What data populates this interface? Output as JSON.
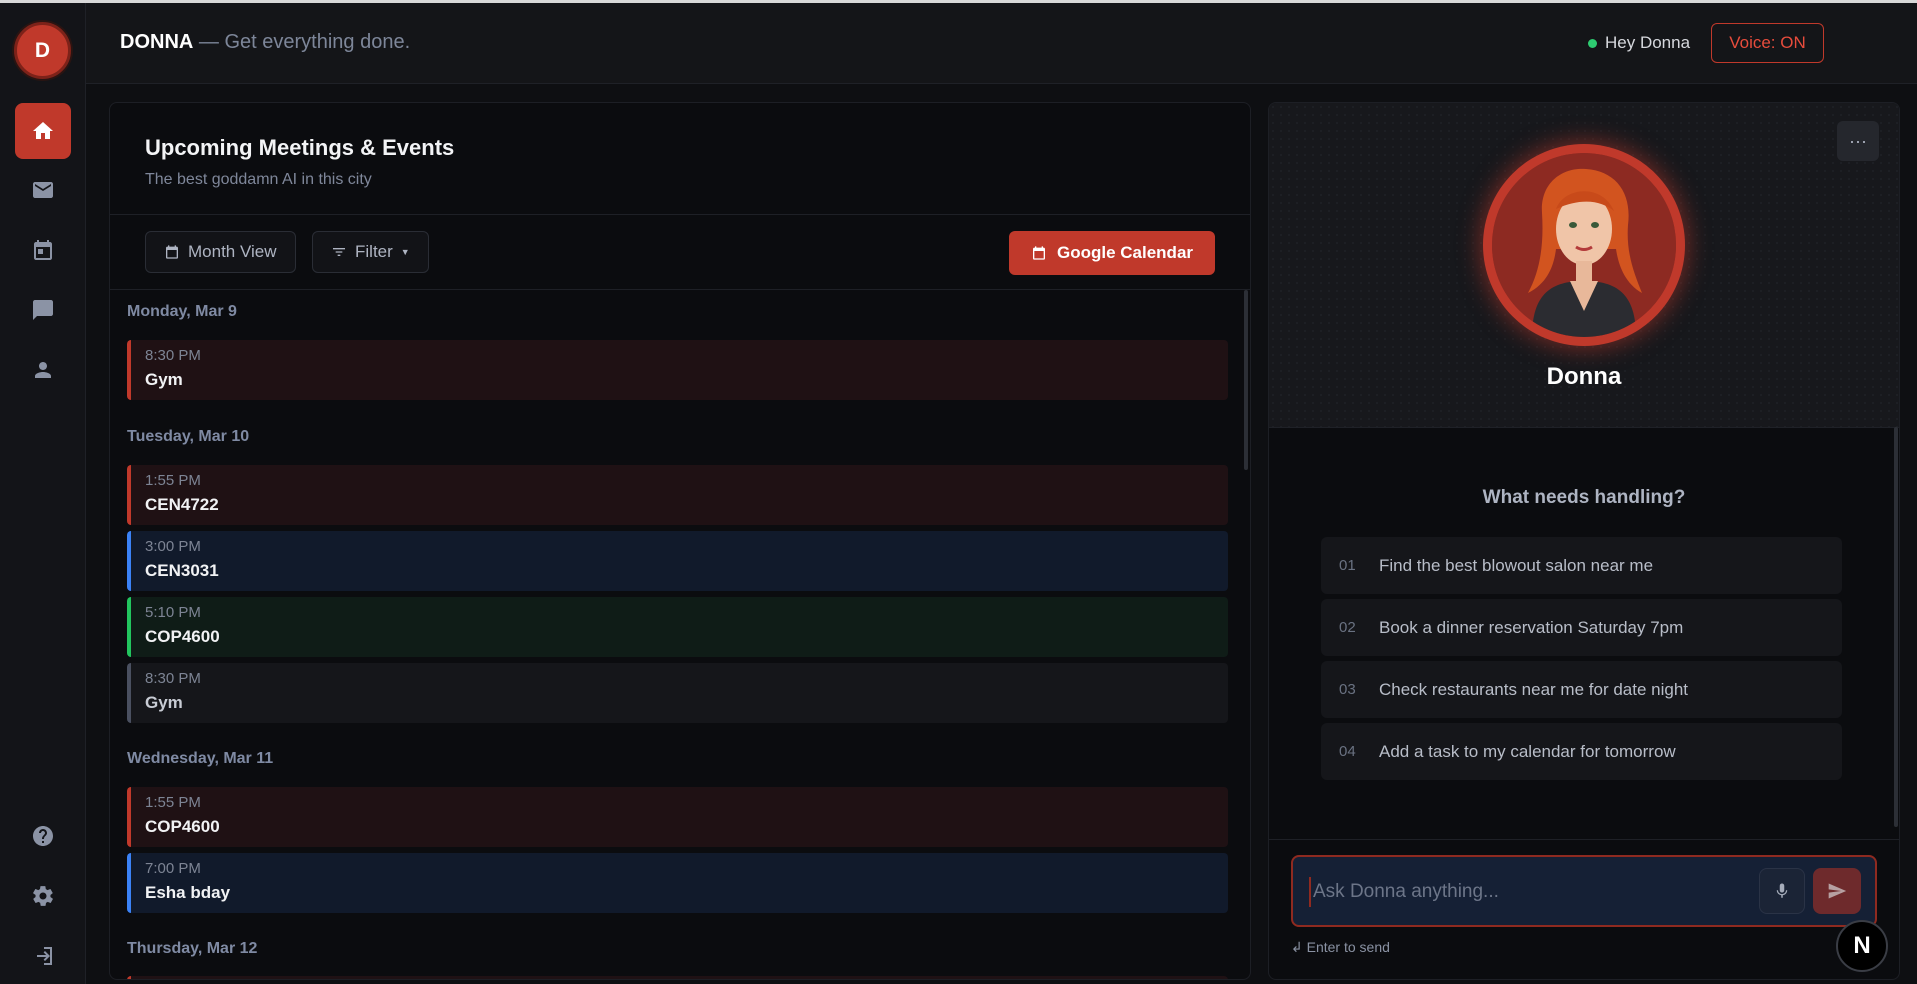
{
  "app": {
    "logo_letter": "D",
    "brand": "DONNA",
    "tagline": " — Get everything done.",
    "status_text": "Hey Donna",
    "voice_button": "Voice: ON",
    "accent_color": "#c0392b",
    "status_color": "#2ecc71"
  },
  "sidebar": {
    "items": [
      {
        "icon": "home-icon",
        "active": true
      },
      {
        "icon": "mail-icon",
        "active": false
      },
      {
        "icon": "calendar-icon",
        "active": false
      },
      {
        "icon": "chat-icon",
        "active": false
      },
      {
        "icon": "person-icon",
        "active": false
      }
    ],
    "bottom_items": [
      "help-icon",
      "settings-icon",
      "logout-icon"
    ]
  },
  "calendar": {
    "title": "Upcoming Meetings & Events",
    "subtitle": "The best goddamn AI in this city",
    "month_view_label": "Month View",
    "filter_label": "Filter",
    "google_calendar_label": "Google Calendar",
    "days": [
      {
        "label": "Monday, Mar 9",
        "events": [
          {
            "time": "8:30 PM",
            "title": "Gym",
            "color": "red"
          }
        ]
      },
      {
        "label": "Tuesday, Mar 10",
        "events": [
          {
            "time": "1:55 PM",
            "title": "CEN4722",
            "color": "red"
          },
          {
            "time": "3:00 PM",
            "title": "CEN3031",
            "color": "blue"
          },
          {
            "time": "5:10 PM",
            "title": "COP4600",
            "color": "green"
          },
          {
            "time": "8:30 PM",
            "title": "Gym",
            "color": "gray"
          }
        ]
      },
      {
        "label": "Wednesday, Mar 11",
        "events": [
          {
            "time": "1:55 PM",
            "title": "COP4600",
            "color": "red"
          },
          {
            "time": "7:00 PM",
            "title": "Esha bday",
            "color": "blue"
          }
        ]
      },
      {
        "label": "Thursday, Mar 12",
        "events": []
      }
    ]
  },
  "assistant": {
    "name": "Donna",
    "more_label": "···",
    "prompt_heading": "What needs handling?",
    "prompts": [
      {
        "num": "01",
        "text": "Find the best blowout salon near me"
      },
      {
        "num": "02",
        "text": "Book a dinner reservation Saturday 7pm"
      },
      {
        "num": "03",
        "text": "Check restaurants near me for date night"
      },
      {
        "num": "04",
        "text": "Add a task to my calendar for tomorrow"
      }
    ],
    "input_placeholder": "Ask Donna anything...",
    "hint": "↲ Enter to send"
  },
  "badge": {
    "letter": "N"
  }
}
